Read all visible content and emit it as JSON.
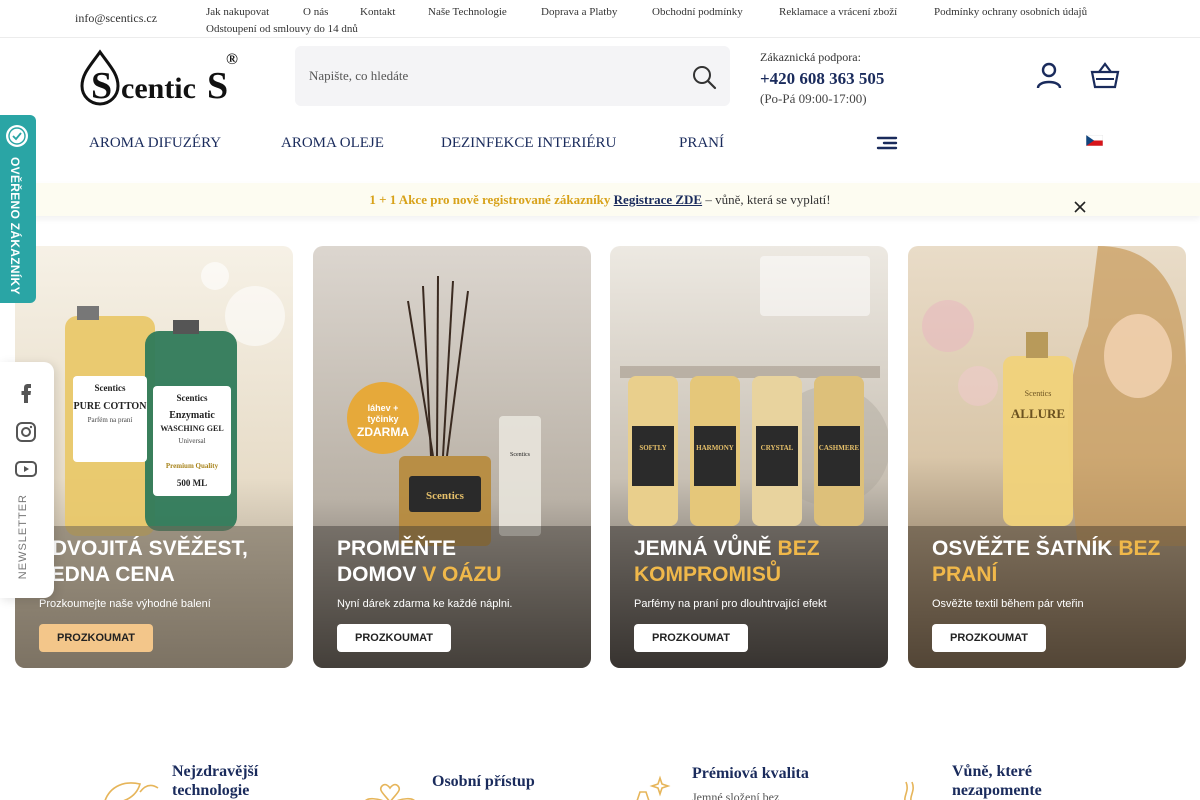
{
  "topbar": {
    "email": "info@scentics.cz",
    "links": [
      "Jak nakupovat",
      "O nás",
      "Kontakt",
      "Naše Technologie",
      "Doprava a Platby",
      "Obchodní podmínky",
      "Reklamace a vrácení zboží",
      "Podmínky ochrany osobních údajů",
      "Odstoupení od smlouvy do 14 dnů"
    ]
  },
  "logo": {
    "text": "Scentics",
    "mark": "®"
  },
  "search": {
    "placeholder": "Napište, co hledáte",
    "icon": "search-icon"
  },
  "support": {
    "label": "Zákaznická podpora:",
    "phone": "+420 608 363 505",
    "hours": "(Po-Pá 09:00-17:00)"
  },
  "nav": {
    "items": [
      "AROMA DIFUZÉRY",
      "AROMA OLEJE",
      "DEZINFEKCE INTERIÉRU",
      "PRANÍ"
    ],
    "chevron": "",
    "lang_chevron": ""
  },
  "promo": {
    "icon_left": "",
    "highlight": "1 + 1 Akce pro nově registrované zákazníky",
    "link": "Registrace ZDE",
    "rest": "– vůně, která se vyplatí!",
    "icon_right": ""
  },
  "verified_badge": {
    "text": "OVĚŘENO ZÁKAZNÍKY",
    "color": "#2aa5a5"
  },
  "social": {
    "icons": [
      "facebook-icon",
      "instagram-icon",
      "youtube-icon"
    ],
    "newsletter": "NEWSLETTER"
  },
  "banners": [
    {
      "title": "ZDVOJITÁ SVĚŽEST,\nJEDNA CENA",
      "subtitle": "Prozkoumejte naše výhodné balení",
      "cta": "PROZKOUMAT",
      "product_labels": [
        "Scentics",
        "PURE COTTON",
        "Parfém na praní",
        "Scentics",
        "Enzymatic",
        "WASCHING GEL",
        "Universal",
        "Premium Quality",
        "500 ML"
      ]
    },
    {
      "title": "PROMĚŇTE\nDOMOV",
      "title_accent": "V OÁZU",
      "subtitle": "Nyní dárek zdarma ke každé náplni.",
      "cta": "PROZKOUMAT",
      "badge": "láhev + tyčinky ZDARMA",
      "product_labels": [
        "Scentics",
        "Scentics"
      ]
    },
    {
      "title": "JEMNÁ VŮNĚ",
      "title_accent": "BEZ KOMPROMISŮ",
      "subtitle": "Parfémy na praní pro dlouhtrvající efekt",
      "cta": "PROZKOUMAT",
      "product_labels": [
        "SOFTLY",
        "HARMONY",
        "CRYSTAL",
        "CASHMERE"
      ]
    },
    {
      "title": "OSVĚŽTE ŠATNÍK",
      "title_accent": "BEZ PRANÍ",
      "subtitle": "Osvěžte textil během pár vteřin",
      "cta": "PROZKOUMAT",
      "product_labels": [
        "Scentics",
        "ALLURE"
      ]
    }
  ],
  "features": [
    {
      "title": "Nejzdravější technologie",
      "desc": ""
    },
    {
      "title": "Osobní přístup",
      "desc": ""
    },
    {
      "title": "Prémiová kvalita",
      "desc": "Jemné složení bez"
    },
    {
      "title": "Vůně, které nezapomente",
      "desc": ""
    }
  ],
  "colors": {
    "brand": "#1a2b5c",
    "accent": "#f0b84a",
    "teal": "#2aa5a5"
  }
}
